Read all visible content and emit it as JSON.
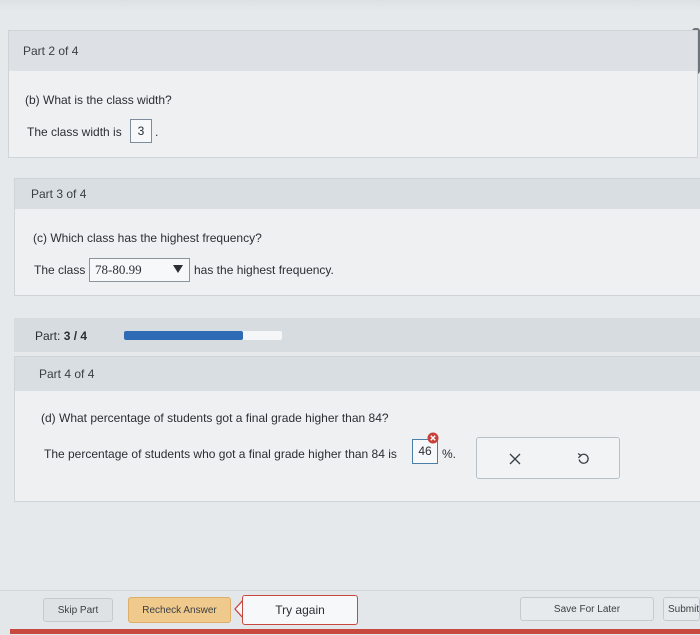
{
  "part2": {
    "header": "Part 2 of 4",
    "question": "(b) What is the class width?",
    "answer_prefix": "The class width is",
    "answer_value": "3",
    "answer_suffix": "."
  },
  "part3": {
    "header": "Part 3 of 4",
    "question": "(c) Which class has the highest frequency?",
    "answer_prefix": "The class",
    "selected_option": "78-80.99",
    "answer_suffix": "has the highest frequency."
  },
  "progress": {
    "label": "Part:",
    "current_total": "3 / 4",
    "fraction": 0.75
  },
  "part4": {
    "header": "Part 4 of 4",
    "question": "(d) What percentage of students got a final grade higher than 84?",
    "answer_prefix": "The percentage of students who got a final grade higher than 84 is",
    "answer_value": "46",
    "answer_suffix": "%."
  },
  "tools": {
    "clear_icon": "close-icon",
    "undo_icon": "undo-icon"
  },
  "actions": {
    "skip": "Skip Part",
    "recheck": "Recheck Answer",
    "try_again": "Try again",
    "save": "Save For Later",
    "submit": "Submit"
  },
  "colors": {
    "progress_fill": "#2f6bb5",
    "error_badge": "#c9403a",
    "recheck_button": "#f0c98c",
    "accent_red": "#c8473f"
  }
}
